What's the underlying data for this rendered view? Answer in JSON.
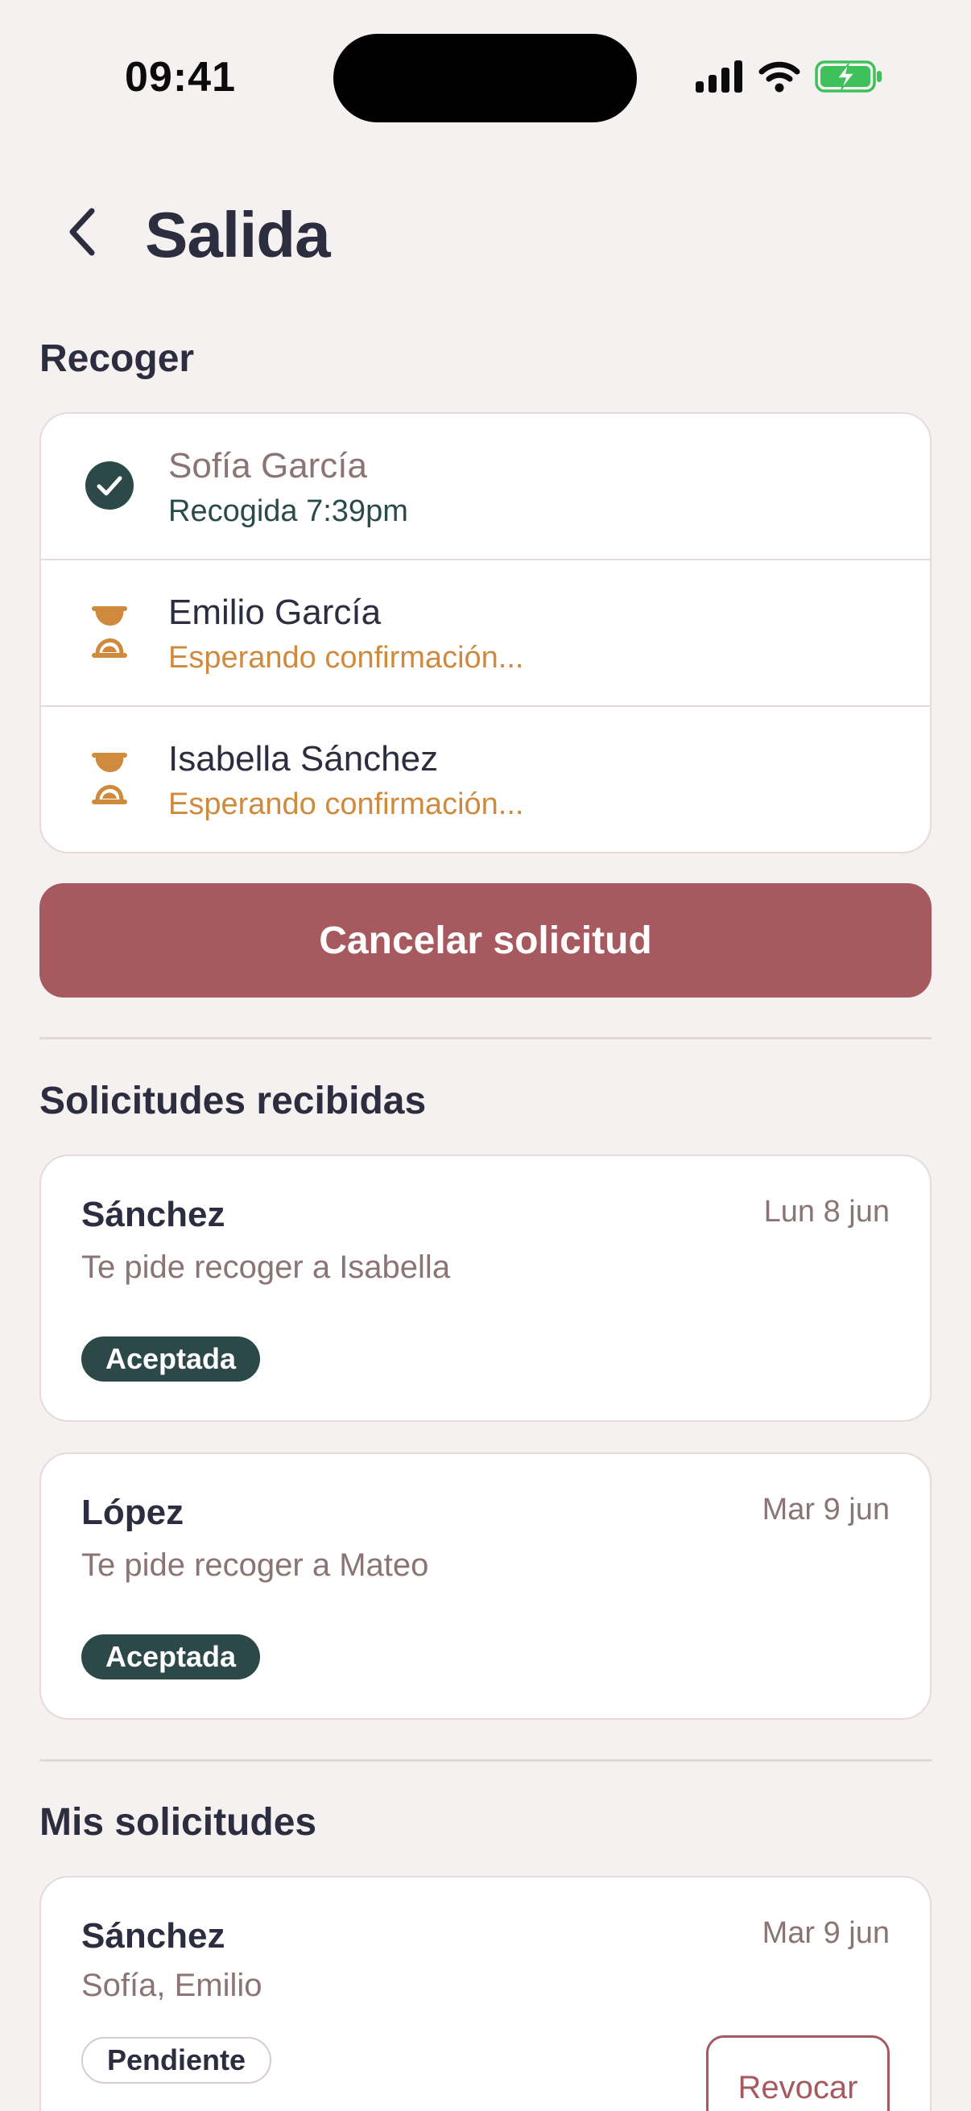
{
  "status_bar": {
    "time": "09:41",
    "icons": [
      "signal-icon",
      "wifi-icon",
      "battery-charging-icon"
    ]
  },
  "header": {
    "title": "Salida",
    "back_icon": "chevron-left-icon"
  },
  "pickup": {
    "section_title": "Recoger",
    "items": [
      {
        "name": "Sofía García",
        "status": "Recogida 7:39pm",
        "icon": "check-circle-icon"
      },
      {
        "name": "Emilio García",
        "status": "Esperando confirmación...",
        "icon": "hourglass-icon"
      },
      {
        "name": "Isabella Sánchez",
        "status": "Esperando confirmación...",
        "icon": "hourglass-icon"
      }
    ],
    "cancel_label": "Cancelar solicitud"
  },
  "received": {
    "section_title": "Solicitudes recibidas",
    "items": [
      {
        "family": "Sánchez",
        "date": "Lun 8 jun",
        "description": "Te pide recoger a Isabella",
        "badge": "Aceptada"
      },
      {
        "family": "López",
        "date": "Mar 9 jun",
        "description": "Te pide recoger a Mateo",
        "badge": "Aceptada"
      }
    ]
  },
  "mine": {
    "section_title": "Mis solicitudes",
    "items": [
      {
        "family": "Sánchez",
        "date": "Mar 9 jun",
        "description": "Sofía, Emilio",
        "badge": "Pendiente",
        "action_label": "Revocar"
      }
    ]
  },
  "colors": {
    "background": "#f5f1f1",
    "accent": "#a65a60",
    "dark_teal": "#2d4848",
    "waiting": "#d08a3e",
    "battery": "#3ec15a"
  }
}
